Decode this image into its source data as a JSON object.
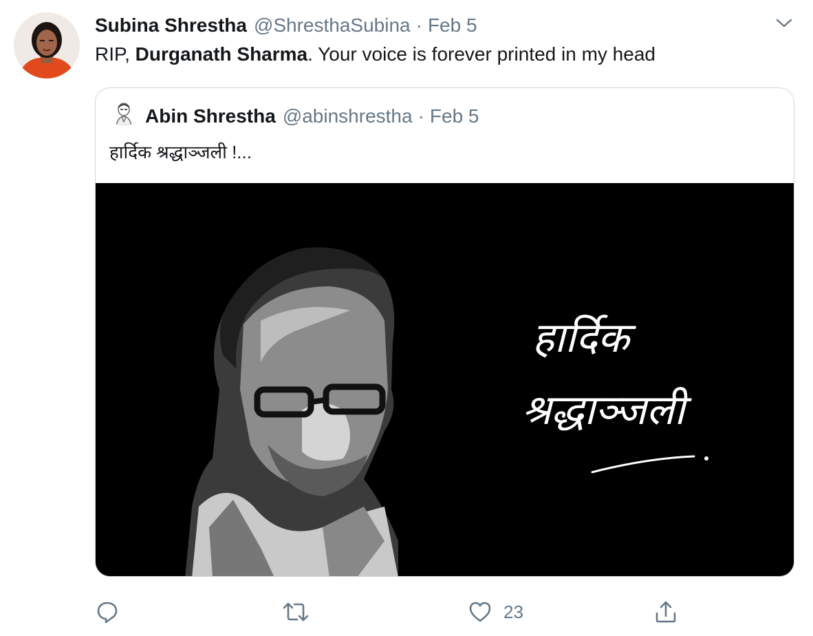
{
  "tweet": {
    "author_name": "Subina Shrestha",
    "author_handle": "@ShresthaSubina",
    "separator": "·",
    "date": "Feb 5",
    "text_prefix": "RIP, ",
    "text_bold": "Durganath Sharma",
    "text_suffix": ". Your voice is forever printed in my head"
  },
  "quoted_tweet": {
    "author_name": "Abin Shrestha",
    "author_handle": "@abinshrestha",
    "separator": "·",
    "date": "Feb 5",
    "text": "हार्दिक श्रद्धाञ्जली !...",
    "image": {
      "overlay_text_line1": "हार्दिक",
      "overlay_text_line2": "श्रद्धाञ्जली"
    }
  },
  "actions": {
    "reply_count": "",
    "retweet_count": "",
    "like_count": "23",
    "share_count": ""
  },
  "icons": {
    "reply": "reply-icon",
    "retweet": "retweet-icon",
    "like": "heart-icon",
    "share": "share-icon",
    "more": "chevron-down-icon"
  },
  "colors": {
    "secondary_text": "#657786",
    "border": "#ccd6dd"
  }
}
